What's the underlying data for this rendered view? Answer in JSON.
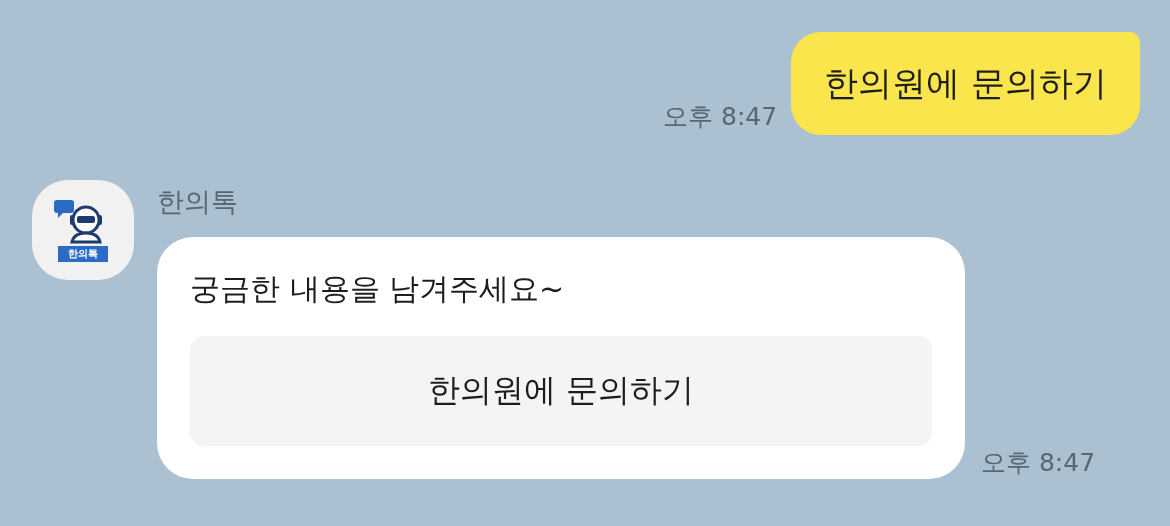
{
  "messages": [
    {
      "kind": "outgoing",
      "text": "한의원에 문의하기",
      "time": "오후 8:47"
    },
    {
      "kind": "incoming",
      "sender": "한의톡",
      "avatar_label": "한의톡",
      "text": "궁금한 내용을 남겨주세요~",
      "button": "한의원에 문의하기",
      "time": "오후 8:47"
    }
  ]
}
